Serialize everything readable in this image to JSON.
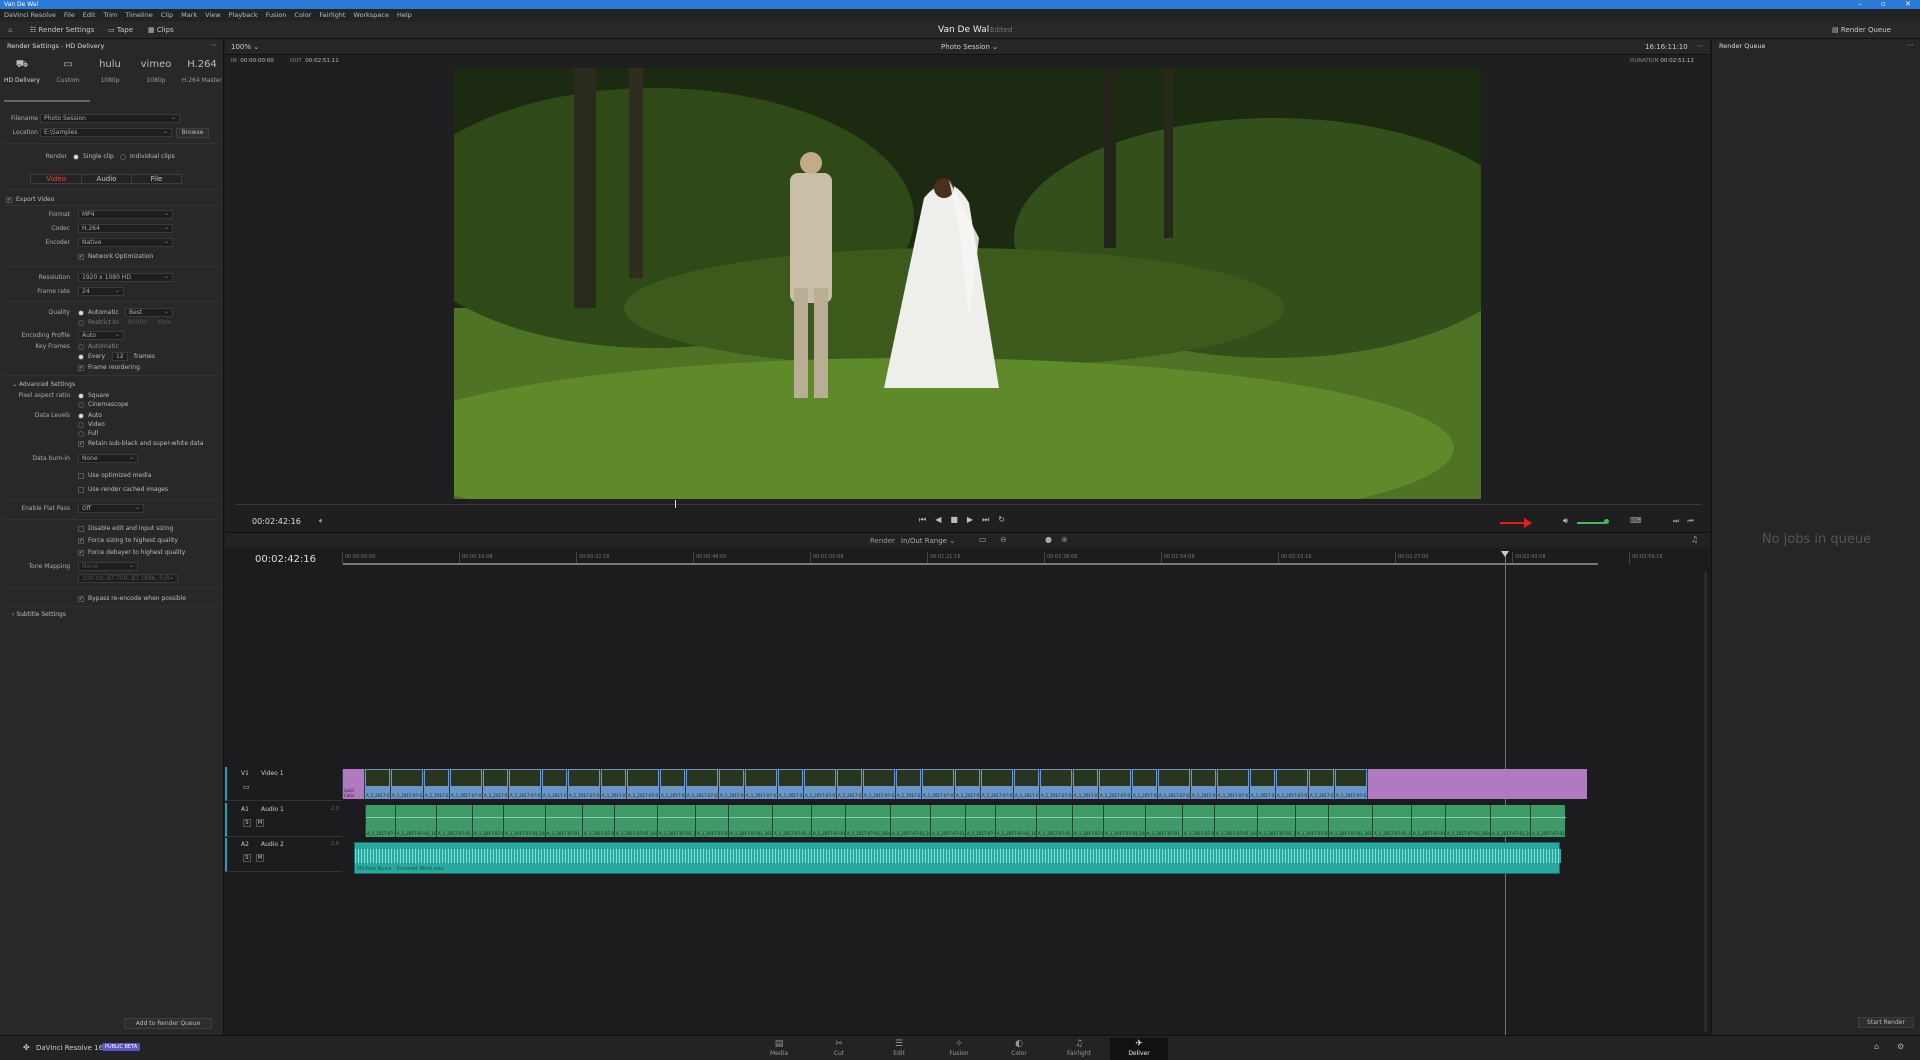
{
  "app": {
    "window_title": "Van De Wal",
    "project_name": "Van De Wal",
    "project_status": "Edited"
  },
  "menu": [
    "DaVinci Resolve",
    "File",
    "Edit",
    "Trim",
    "Timeline",
    "Clip",
    "Mark",
    "View",
    "Playback",
    "Fusion",
    "Color",
    "Fairlight",
    "Workspace",
    "Help"
  ],
  "toolbar": {
    "render_settings": "Render Settings",
    "tape": "Tape",
    "clips": "Clips",
    "render_queue": "Render Queue"
  },
  "render_settings": {
    "title": "Render Settings - HD Delivery",
    "presets": [
      {
        "label": "HD Delivery",
        "icon": "⛟"
      },
      {
        "label": "Custom",
        "icon": "▭"
      },
      {
        "label": "1080p",
        "icon": "hulu"
      },
      {
        "label": "1080p",
        "icon": "vimeo"
      },
      {
        "label": "H.264 Master",
        "icon": "H.264"
      }
    ],
    "filename_label": "Filename",
    "filename": "Photo Session",
    "location_label": "Location",
    "location": "E:\\Samples",
    "browse": "Browse",
    "render_label": "Render",
    "single_clip": "Single clip",
    "individual_clips": "Individual clips",
    "tabs": [
      "Video",
      "Audio",
      "File"
    ],
    "export_video": "Export Video",
    "format_label": "Format",
    "format": "MP4",
    "codec_label": "Codec",
    "codec": "H.264",
    "encoder_label": "Encoder",
    "encoder": "Native",
    "network_opt": "Network Optimization",
    "resolution_label": "Resolution",
    "resolution": "1920 x 1080 HD",
    "framerate_label": "Frame rate",
    "framerate": "24",
    "quality_label": "Quality",
    "quality_auto": "Automatic",
    "quality_value": "Best",
    "restrict_to": "Restrict to",
    "restrict_value": "80000",
    "restrict_unit": "Kb/s",
    "profile_label": "Encoding Profile",
    "profile": "Auto",
    "keyframes_label": "Key Frames",
    "keyframes_auto": "Automatic",
    "keyframes_every": "Every",
    "keyframes_value": "12",
    "keyframes_unit": "frames",
    "frame_reordering": "Frame reordering",
    "advanced": "Advanced Settings",
    "pixel_aspect_label": "Pixel aspect ratio",
    "pixel_square": "Square",
    "pixel_cinemascope": "Cinemascope",
    "data_levels_label": "Data Levels",
    "dl_auto": "Auto",
    "dl_video": "Video",
    "dl_full": "Full",
    "retain": "Retain sub-black and super-white data",
    "burnin_label": "Data burn-in",
    "burnin": "None",
    "use_optimized": "Use optimized media",
    "use_cached": "Use render cached images",
    "flat_pass_label": "Enable Flat Pass",
    "flat_pass": "Off",
    "disable_edit": "Disable edit and input sizing",
    "force_sizing": "Force sizing to highest quality",
    "force_debayer": "Force debayer to highest quality",
    "tone_label": "Tone Mapping",
    "tone": "None",
    "tone_sub": "100 nit, BT.709, BT.1886, Full",
    "bypass": "Bypass re-encode when possible",
    "subtitle": "Subtitle Settings",
    "add_queue": "Add to Render Queue"
  },
  "viewer": {
    "zoom": "100%",
    "clip_name": "Photo Session",
    "timecode_top": "16:16:11:10",
    "in_label": "IN",
    "in": "00:00:00:00",
    "out_label": "OUT",
    "out": "00:02:51:11",
    "duration_label": "DURATION",
    "duration": "00:02:51:12",
    "current_tc": "00:02:42:16",
    "render_label": "Render",
    "render_range": "In/Out Range"
  },
  "timeline": {
    "current_tc": "00:02:42:16",
    "ruler": [
      "00:00:00:00",
      "00:00:16:08",
      "00:00:32:16",
      "00:00:49:00",
      "00:01:05:08",
      "00:01:21:16",
      "00:01:38:00",
      "00:01:54:08",
      "00:02:10:16",
      "00:02:27:00",
      "00:02:43:08",
      "00:02:59:16"
    ],
    "tracks": [
      {
        "id": "V1",
        "name": "Video 1"
      },
      {
        "id": "A1",
        "name": "Audio 1",
        "ch": "2.0"
      },
      {
        "id": "A2",
        "name": "Audio 2",
        "ch": "2.0"
      }
    ],
    "a2_clip": "Michele Buice - Summer Wind.wav",
    "v1_first_clip": "Solid Color",
    "clip_label": "A_1_2017-07-01_1616_C..."
  },
  "render_queue": {
    "title": "Render Queue",
    "empty": "No jobs in queue",
    "start": "Start Render"
  },
  "bottom": {
    "app_version": "DaVinci Resolve 16",
    "beta": "PUBLIC BETA",
    "pages": [
      {
        "label": "Media",
        "icon": "▤"
      },
      {
        "label": "Cut",
        "icon": "✂"
      },
      {
        "label": "Edit",
        "icon": "☰"
      },
      {
        "label": "Fusion",
        "icon": "✧"
      },
      {
        "label": "Color",
        "icon": "◐"
      },
      {
        "label": "Fairlight",
        "icon": "♫"
      },
      {
        "label": "Deliver",
        "icon": "✈"
      }
    ]
  },
  "colors": {
    "accent": "#e8493b",
    "selected_page": "#111112",
    "arrow": "#e0201e"
  }
}
